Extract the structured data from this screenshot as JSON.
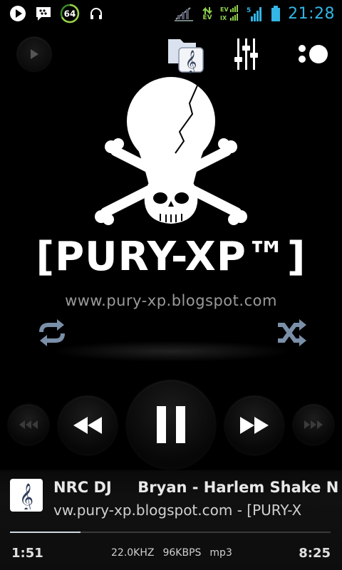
{
  "status_bar": {
    "icons": [
      "play-notification-icon",
      "bbm-chat-icon",
      "badge-64-icon",
      "headphones-icon",
      "no-signal-icon",
      "data-arrows-icon",
      "ev-signal-icon",
      "signal-bars-icon",
      "battery-icon"
    ],
    "badge_number": "64",
    "ev_label": "EV",
    "signal_type": "5",
    "time": "21:28",
    "accent": "#33b5e5"
  },
  "toolbar": {
    "icons": [
      "play-small-icon",
      "music-folder-icon",
      "equalizer-icon",
      "options-dots-icon"
    ]
  },
  "artwork": {
    "logo_text": "[PURY-XP™]",
    "url_text": "www.pury-xp.blogspot.com"
  },
  "controls": {
    "icons": [
      "repeat-icon",
      "shuffle-icon",
      "skip-back-icon",
      "rewind-icon",
      "pause-icon",
      "fast-forward-icon",
      "skip-forward-icon"
    ]
  },
  "now_playing": {
    "title": "NRC DJ     Bryan - Harlem Shake New",
    "subtitle": "vw.pury-xp.blogspot.com - [PURY-X",
    "elapsed": "1:51",
    "total": "8:25",
    "sample_rate": "22.0KHZ",
    "bitrate": "96KBPS",
    "format": "mp3",
    "progress": 0.22
  }
}
